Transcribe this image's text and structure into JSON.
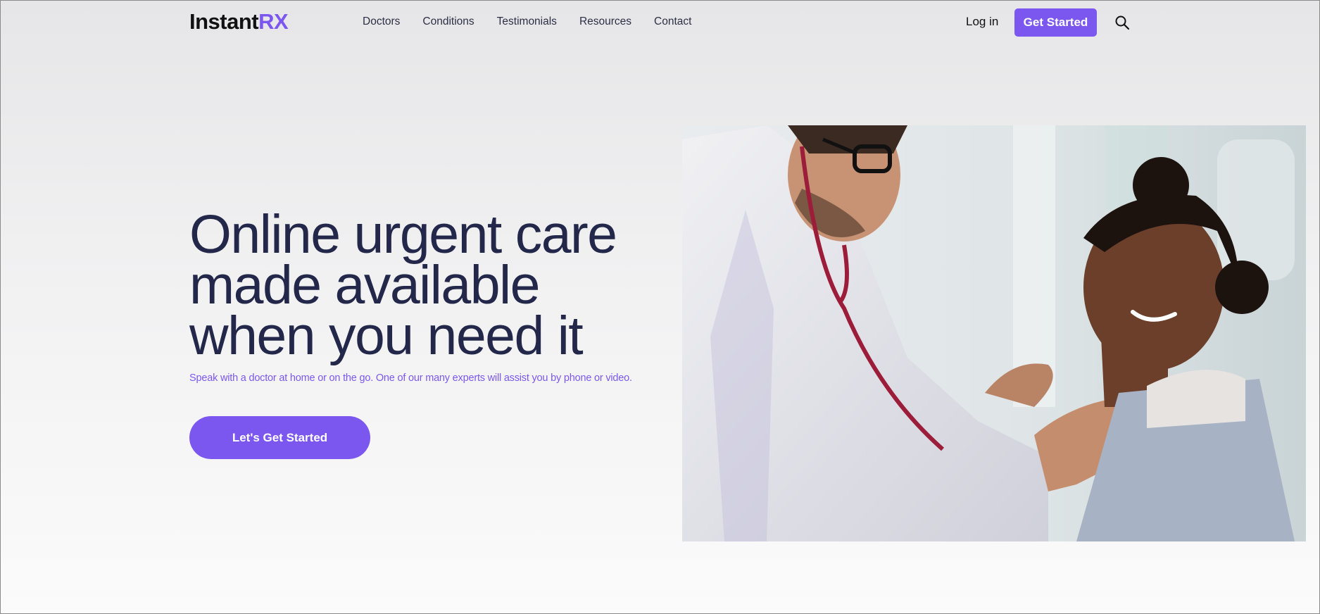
{
  "brand": {
    "name_main": "Instant",
    "name_accent": "RX",
    "accent_color": "#7b57f0"
  },
  "nav": {
    "items": [
      {
        "label": "Doctors"
      },
      {
        "label": "Conditions"
      },
      {
        "label": "Testimonials"
      },
      {
        "label": "Resources"
      },
      {
        "label": "Contact"
      }
    ]
  },
  "header": {
    "login_label": "Log in",
    "get_started_label": "Get Started",
    "search_icon": "search-icon"
  },
  "hero": {
    "title_line1": "Online urgent care",
    "title_line2": "made available",
    "title_line3": "when you need it",
    "subtitle": "Speak with a doctor at home or on the go. One of our many experts will assist you by phone or video.",
    "cta_label": "Let's Get Started",
    "image": "doctor-with-stethoscope-examining-smiling-girl-photo"
  },
  "colors": {
    "title": "#23284a",
    "button": "#7b57f0"
  }
}
